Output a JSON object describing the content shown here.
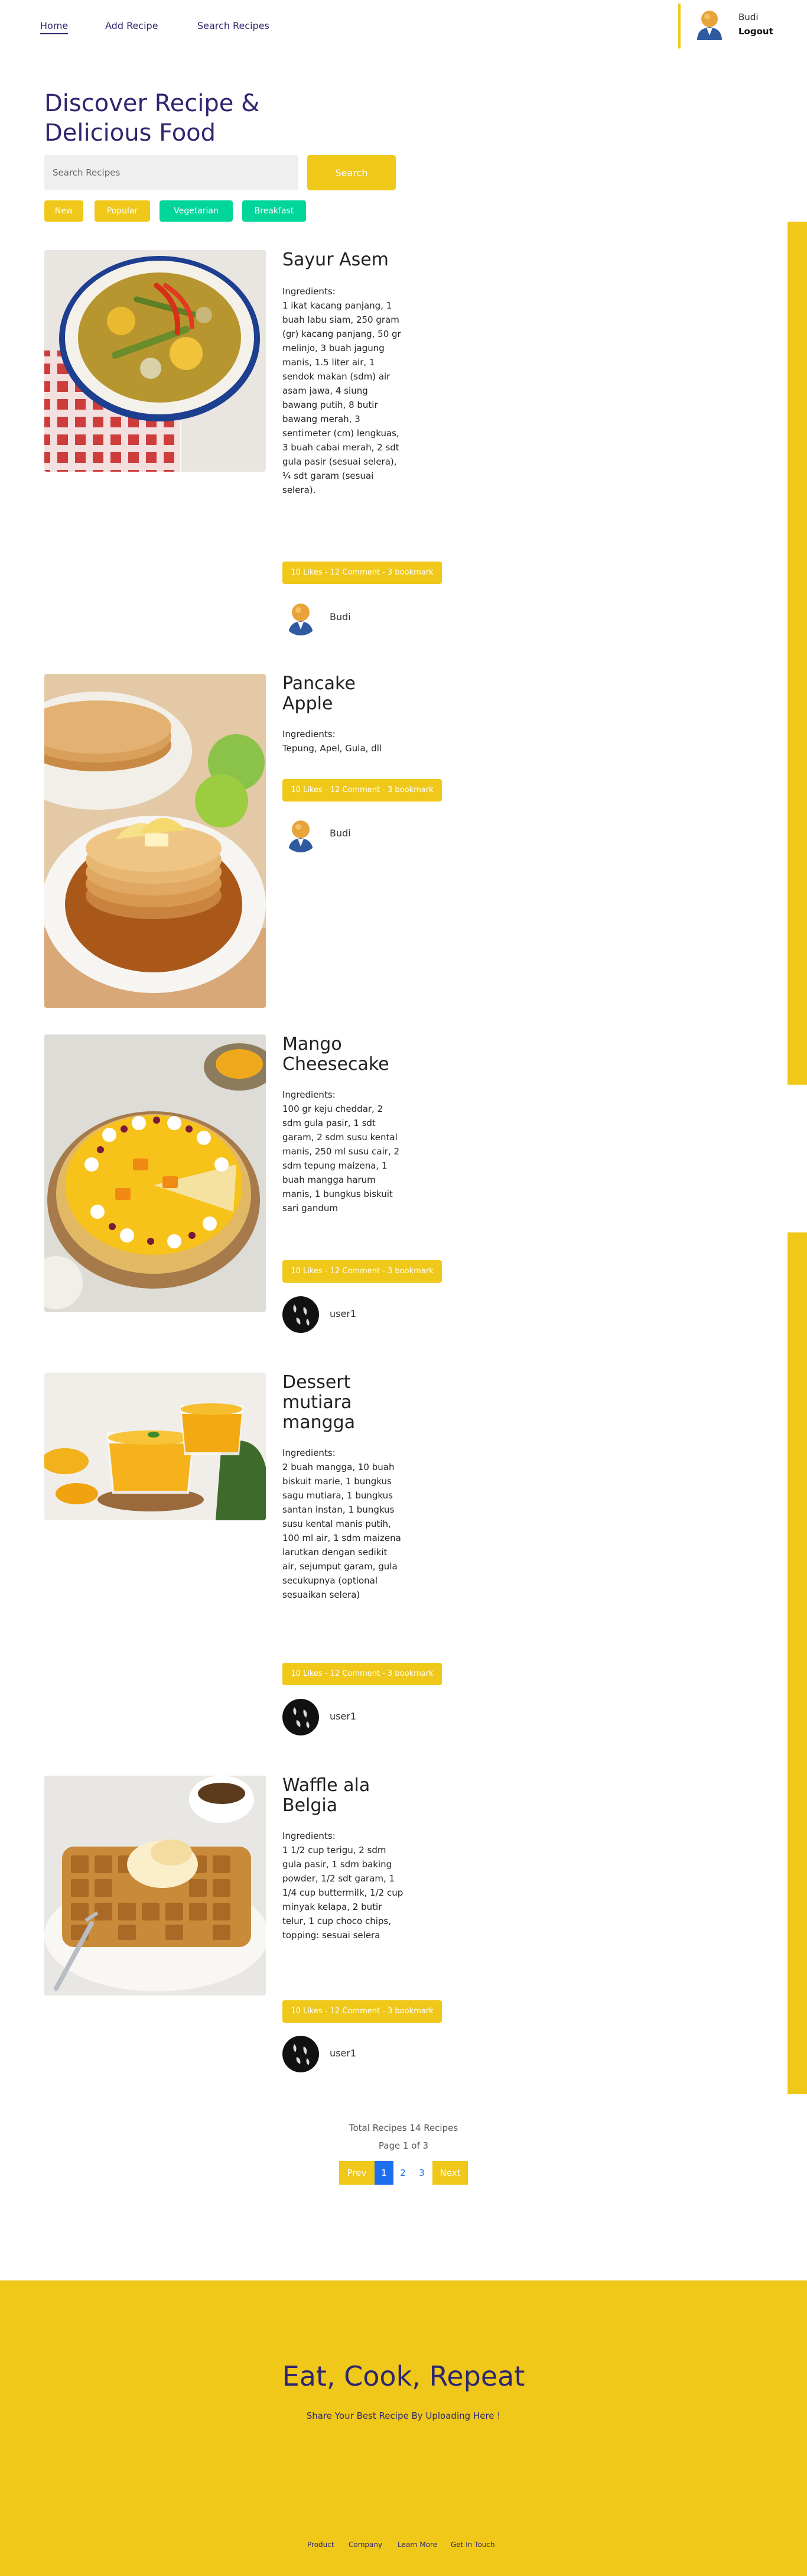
{
  "nav": {
    "links": [
      "Home",
      "Add Recipe",
      "Search Recipes"
    ],
    "username": "Budi",
    "logout": "Logout"
  },
  "hero": {
    "title": "Discover Recipe & Delicious Food",
    "search_placeholder": "Search Recipes",
    "search_button": "Search",
    "tags": [
      "New",
      "Popular",
      "Vegetarian",
      "Breakfast"
    ]
  },
  "recipes": [
    {
      "title": "Sayur Asem",
      "ingredients_label": "Ingredients:",
      "ingredients": "1 ikat kacang panjang, 1 buah labu siam, 250 gram (gr) kacang panjang, 50 gr melinjo, 3 buah jagung manis, 1.5 liter air, 1 sendok makan (sdm) air asam jawa, 4 siung bawang putih, 8 butir bawang merah, 3 sentimeter (cm) lengkuas, 3 buah cabai merah, 2 sdt gula pasir (sesuai selera), ¼ sdt garam (sesuai selera).",
      "stats": "10 Likes - 12 Comment - 3 bookmark",
      "author": "Budi"
    },
    {
      "title": "Pancake Apple",
      "ingredients_label": "Ingredients:",
      "ingredients": "Tepung, Apel, Gula, dll",
      "stats": "10 Likes - 12 Comment - 3 bookmark",
      "author": "Budi"
    },
    {
      "title": "Mango Cheesecake",
      "ingredients_label": "Ingredients:",
      "ingredients": "100 gr keju cheddar, 2 sdm gula pasir, 1 sdt garam, 2 sdm susu kental manis, 250 ml susu cair, 2 sdm tepung maizena, 1 buah mangga harum manis, 1 bungkus biskuit sari gandum",
      "stats": "10 Likes - 12 Comment - 3 bookmark",
      "author": "user1"
    },
    {
      "title": "Dessert mutiara mangga",
      "ingredients_label": "Ingredients:",
      "ingredients": "2 buah mangga, 10 buah biskuit marie, 1 bungkus sagu mutiara, 1 bungkus santan instan, 1 bungkus susu kental manis putih, 100 ml air, 1 sdm maizena larutkan dengan sedikit air, sejumput garam, gula secukupnya (optional sesuaikan selera)",
      "stats": "10 Likes - 12 Comment - 3 bookmark",
      "author": "user1"
    },
    {
      "title": "Waffle ala Belgia",
      "ingredients_label": "Ingredients:",
      "ingredients": "1 1/2 cup terigu, 2 sdm gula pasir, 1 sdm baking powder, 1/2 sdt garam, 1 1/4 cup buttermilk, 1/2 cup minyak kelapa, 2 butir telur, 1 cup choco chips, topping: sesuai selera",
      "stats": "10 Likes - 12 Comment - 3 bookmark",
      "author": "user1"
    }
  ],
  "pagination": {
    "total": "Total Recipes 14 Recipes",
    "page": "Page 1 of 3",
    "prev": "Prev",
    "pages": [
      "1",
      "2",
      "3"
    ],
    "next": "Next"
  },
  "footer": {
    "title": "Eat, Cook, Repeat",
    "subtitle": "Share Your Best Recipe By Uploading Here !",
    "links": [
      "Product",
      "Company",
      "Learn More",
      "Get In Touch"
    ]
  },
  "colors": {
    "accent": "#efc81a",
    "brand_text": "#2e266f",
    "tag_green": "#00d69a",
    "page_active": "#1e6ef0"
  }
}
